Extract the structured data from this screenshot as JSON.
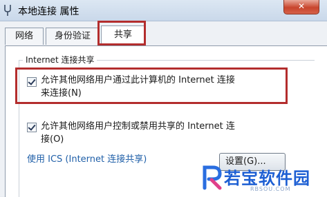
{
  "window": {
    "title": "本地连接 属性",
    "close_label": "✕"
  },
  "tabs": [
    {
      "label": "网络",
      "active": false
    },
    {
      "label": "身份验证",
      "active": false
    },
    {
      "label": "共享",
      "active": true
    }
  ],
  "group": {
    "legend": "Internet 连接共享",
    "option1": {
      "line1": "允许其他网络用户通过此计算机的 Internet 连接",
      "line2": "来连接(N)",
      "checked": true
    },
    "option2": {
      "line1": "允许其他网络用户控制或禁用共享的 Internet 连",
      "line2": "接(O)",
      "checked": true
    },
    "link": "使用 ICS (Internet 连接共享)",
    "settings_button": "设置(G)..."
  },
  "watermark": {
    "text": "若宝软件园",
    "sub": "RBSOU.COM"
  },
  "colors": {
    "highlight": "#b32d2d",
    "link": "#1f5fa8",
    "watermark": "#1d5fd3"
  }
}
